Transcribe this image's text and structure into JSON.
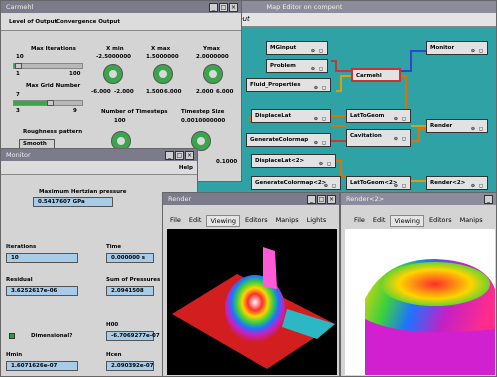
{
  "map_editor": {
    "title": "Map Editor on compent",
    "menu_label": "Layout",
    "nodes": [
      {
        "name": "MGinput",
        "ports": "⊙ ◻"
      },
      {
        "name": "Problem",
        "ports": "⊙ ◻"
      },
      {
        "name": "Fluid_Properties",
        "ports": "⊙ ◻"
      },
      {
        "name": "Carmehl",
        "ports": "⊙ ◻"
      },
      {
        "name": "Monitor",
        "ports": "⊙ ◻"
      },
      {
        "name": "DisplaceLat",
        "ports": "⊙ ◻"
      },
      {
        "name": "LatToGeom",
        "ports": "⊙ ◻"
      },
      {
        "name": "GenerateColormap",
        "ports": "⊙ ◻"
      },
      {
        "name": "Cavitation",
        "ports": "⊙ ◻"
      },
      {
        "name": "Render",
        "ports": "⊙ ◻"
      },
      {
        "name": "DisplaceLat<2>",
        "ports": "⊙ ◻"
      },
      {
        "name": "GenerateColormap<2>",
        "ports": "⊙ ◻"
      },
      {
        "name": "LatToGeom<2>",
        "ports": "⊙ ◻"
      },
      {
        "name": "Render<2>",
        "ports": "⊙ ◻"
      }
    ]
  },
  "carmehl": {
    "title": "Carmehl",
    "level_of_output": "Level of Output",
    "convergence_output": "Convergence Output",
    "max_iterations": {
      "label": "Max Iterations",
      "value": "10",
      "min": "1",
      "max": "100",
      "fraction": 0.08
    },
    "max_grid": {
      "label": "Max Grid Number",
      "value": "7",
      "min": "3",
      "max": "9",
      "fraction": 0.55
    },
    "roughness": {
      "label": "Roughness pattern",
      "value": "Smooth"
    },
    "xmin": {
      "label": "X min",
      "value": "-2.5000000",
      "min": "-6.000",
      "max": "-2.000"
    },
    "xmax": {
      "label": "X max",
      "value": "1.5000000",
      "min": "1.500",
      "max": "6.000"
    },
    "ymax": {
      "label": "Ymax",
      "value": "2.0000000",
      "min": "2.000",
      "max": "6.000"
    },
    "timesteps": {
      "label": "Number of Timesteps",
      "value": "100"
    },
    "timestep_size": {
      "label": "Timestep Size",
      "value": "0.0010000000"
    },
    "small_value": "0.1000",
    "buttons": [
      "✕",
      "□",
      "×"
    ]
  },
  "monitor": {
    "title": "Monitor",
    "help": "Help",
    "max_pressure": {
      "label": "Maximum Hertzian pressure",
      "value": "0.5417607 GPa"
    },
    "iterations": {
      "label": "Iterations",
      "value": "10"
    },
    "time": {
      "label": "Time",
      "value": "0.000000 s"
    },
    "residual": {
      "label": "Residual",
      "value": "3.6252617e-06"
    },
    "sum_pressures": {
      "label": "Sum of Pressures",
      "value": "2.0941508"
    },
    "h00": {
      "label": "H00",
      "value": "-6.7069277e-07"
    },
    "dimensional": {
      "label": "Dimensional?"
    },
    "hmin": {
      "label": "Hmin",
      "value": "1.6071626e-07"
    },
    "hcen": {
      "label": "Hcen",
      "value": "2.090392e-07"
    }
  },
  "render1": {
    "title": "Render",
    "menu": [
      "File",
      "Edit",
      "Viewing",
      "Editors",
      "Manips",
      "Lights"
    ],
    "selected": "Viewing"
  },
  "render2": {
    "title": "Render<2>",
    "menu": [
      "File",
      "Edit",
      "Viewing",
      "Editors",
      "Manips"
    ],
    "selected": "Viewing"
  },
  "colors": {
    "accent": "#2a6fa5",
    "slider": "#3aa54a",
    "map_bg": "#2ea2a4",
    "field": "#a8cce8"
  }
}
